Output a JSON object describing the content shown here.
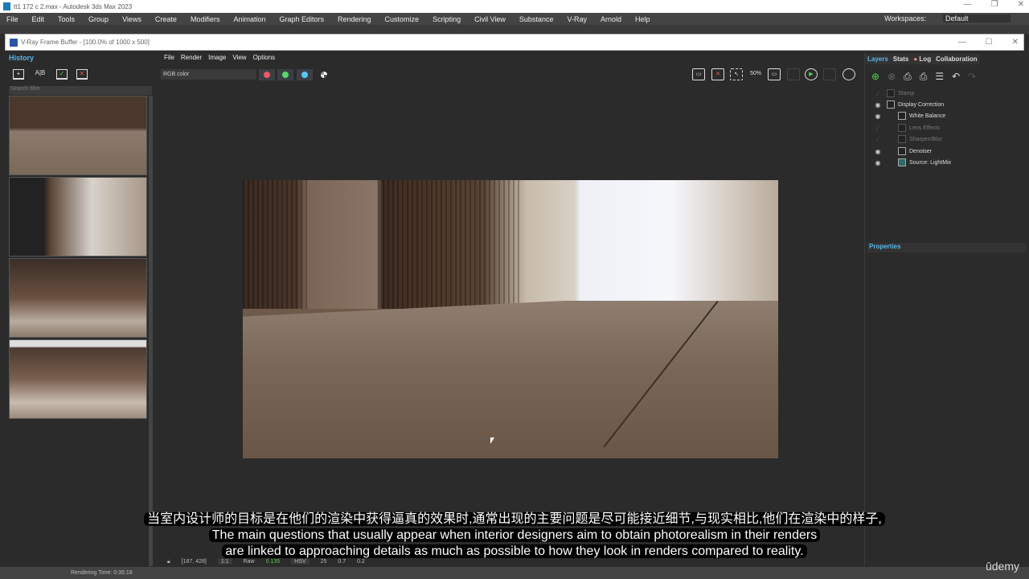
{
  "app": {
    "title": "tt1 172 c 2.max - Autodesk 3ds Max 2023",
    "menu": [
      "File",
      "Edit",
      "Tools",
      "Group",
      "Views",
      "Create",
      "Modifiers",
      "Animation",
      "Graph Editors",
      "Rendering",
      "Customize",
      "Scripting",
      "Civil View",
      "Substance",
      "V-Ray",
      "Arnold",
      "Help"
    ],
    "workspaces_label": "Workspaces:",
    "workspace": "Default"
  },
  "vfb": {
    "title": "V-Ray Frame Buffer - [100.0% of 1000 x 500]",
    "menu": [
      "File",
      "Render",
      "Image",
      "View",
      "Options"
    ],
    "channel": "RGB color",
    "channel_colors": [
      "#e85a6a",
      "#5ad66a",
      "#5ac8ee"
    ],
    "toolbar_icons": [
      "save-icon",
      "clear-image-icon",
      "region-render-icon",
      "zoom-50-icon",
      "display-icon",
      "track-mouse-icon",
      "render-teapot-icon",
      "interactive-render-icon",
      "render-last-icon"
    ],
    "zoom_label": "50%"
  },
  "history": {
    "tab": "History",
    "search_placeholder": "Search filter",
    "icons": [
      "save-to-history-icon",
      "ab-compare-icon",
      "load-icon",
      "remove-icon"
    ],
    "ab_label": "A|B"
  },
  "layers": {
    "tabs": [
      "Layers",
      "Stats",
      "Log",
      "Collaboration"
    ],
    "items": [
      {
        "label": "Stamp",
        "visible": false,
        "indent": 0
      },
      {
        "label": "Display Correction",
        "visible": true,
        "indent": 0
      },
      {
        "label": "White Balance",
        "visible": true,
        "indent": 1
      },
      {
        "label": "Lens Effects",
        "visible": false,
        "indent": 1
      },
      {
        "label": "Sharpen/Blur",
        "visible": false,
        "indent": 1
      },
      {
        "label": "Denoiser",
        "visible": true,
        "indent": 1
      },
      {
        "label": "Source: LightMix",
        "visible": true,
        "indent": 1
      }
    ],
    "properties": "Properties"
  },
  "status": {
    "coords": "[187, 428]",
    "zoom": "1:1",
    "mode": "Raw",
    "value": "0.135",
    "color_space": "HSV",
    "h": "25",
    "s": "0.7",
    "v": "0.2"
  },
  "bottom": {
    "rendering_time": "Rendering Time: 0:35:18"
  },
  "subtitle": {
    "zh": "当室内设计师的目标是在他们的渲染中获得逼真的效果时,通常出现的主要问题是尽可能接近细节,与现实相比,他们在渲染中的样子,",
    "en1": "The main questions that usually appear when interior designers aim to obtain photorealism in their renders",
    "en2": "are linked to approaching details as much as possible to how they look in renders compared to reality."
  },
  "watermark": "ûdemy"
}
